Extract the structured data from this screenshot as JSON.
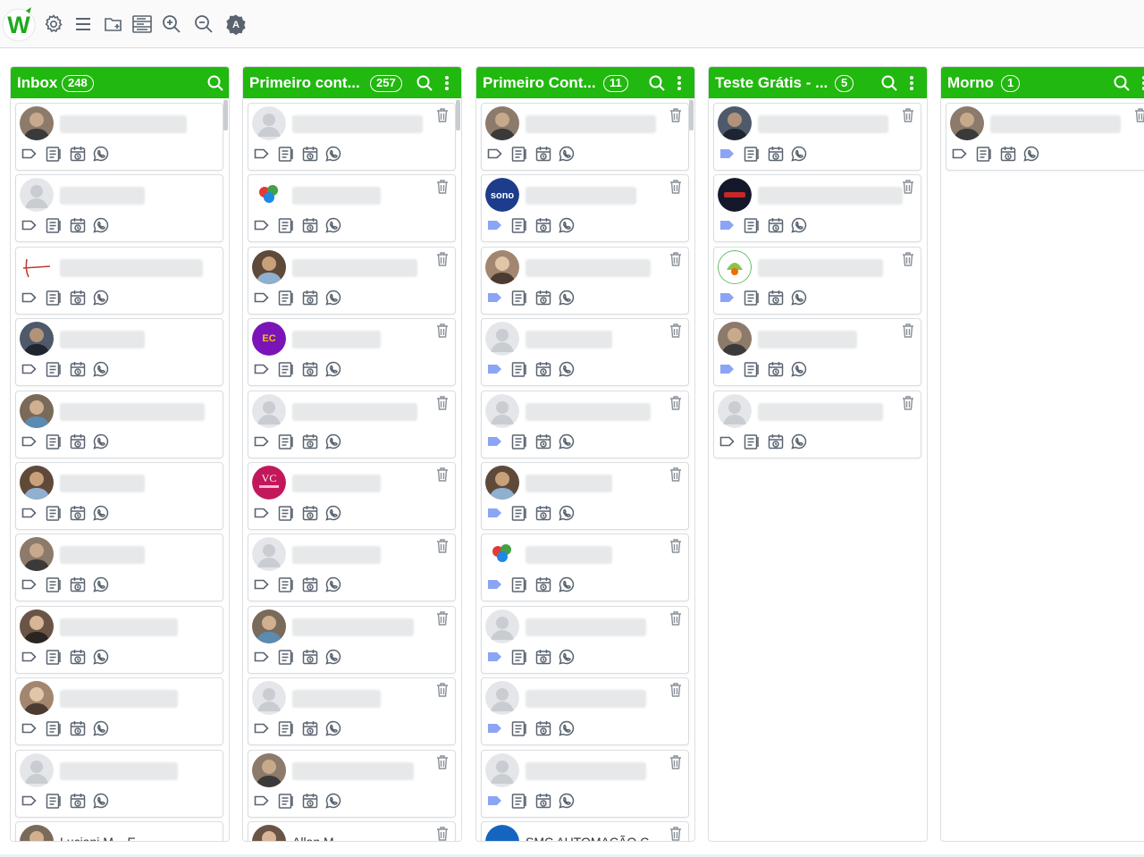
{
  "app": {
    "logo_text": "W",
    "brand_color": "#21b80f"
  },
  "toolbar": [
    {
      "name": "settings-gear-icon"
    },
    {
      "name": "menu-hamburger-icon"
    },
    {
      "name": "new-folder-icon"
    },
    {
      "name": "list-view-icon"
    },
    {
      "name": "zoom-in-icon"
    },
    {
      "name": "zoom-out-icon"
    },
    {
      "name": "auto-badge-icon"
    }
  ],
  "columns": [
    {
      "title": "Inbox",
      "count": "248",
      "has_menu": false
    },
    {
      "title": "Primeiro cont...",
      "count": "257",
      "has_menu": true
    },
    {
      "title": "Primeiro Cont...",
      "count": "11",
      "has_menu": true
    },
    {
      "title": "Teste Grátis - ...",
      "count": "5",
      "has_menu": true
    },
    {
      "title": "Morno",
      "count": "1",
      "has_menu": true
    }
  ],
  "cards": [
    [
      "photo",
      "default",
      "logo-red",
      "photo",
      "photo",
      "photo",
      "photo",
      "photo",
      "photo",
      "default",
      "photo"
    ],
    [
      "default",
      "logo-colorful",
      "photo",
      "logo-purple",
      "default",
      "logo-vc",
      "default",
      "photo",
      "default",
      "photo",
      "photo"
    ],
    [
      "photo",
      "logo-sono",
      "photo",
      "default",
      "default",
      "photo",
      "logo-colorful",
      "default",
      "default",
      "default",
      "logo-smc"
    ],
    [
      "photo",
      "logo-dark",
      "logo-green",
      "photo",
      "default"
    ],
    [
      "photo"
    ]
  ],
  "card_labels": {
    "sono": "sono",
    "ec": "EC",
    "vc": "VC"
  },
  "partial_texts": {
    "col1_last": "Luciani M... E...",
    "col2_last": "Allan M...",
    "col3_last": "SMC AUTOMAÇÃO C..."
  },
  "tag_filled": [
    [
      false,
      false,
      false,
      false,
      false,
      false,
      false,
      false,
      false,
      false,
      false
    ],
    [
      false,
      false,
      false,
      false,
      false,
      false,
      false,
      false,
      false,
      false,
      false
    ],
    [
      false,
      true,
      true,
      true,
      true,
      true,
      true,
      true,
      true,
      true,
      true
    ],
    [
      true,
      true,
      true,
      true,
      false
    ],
    [
      false
    ]
  ]
}
